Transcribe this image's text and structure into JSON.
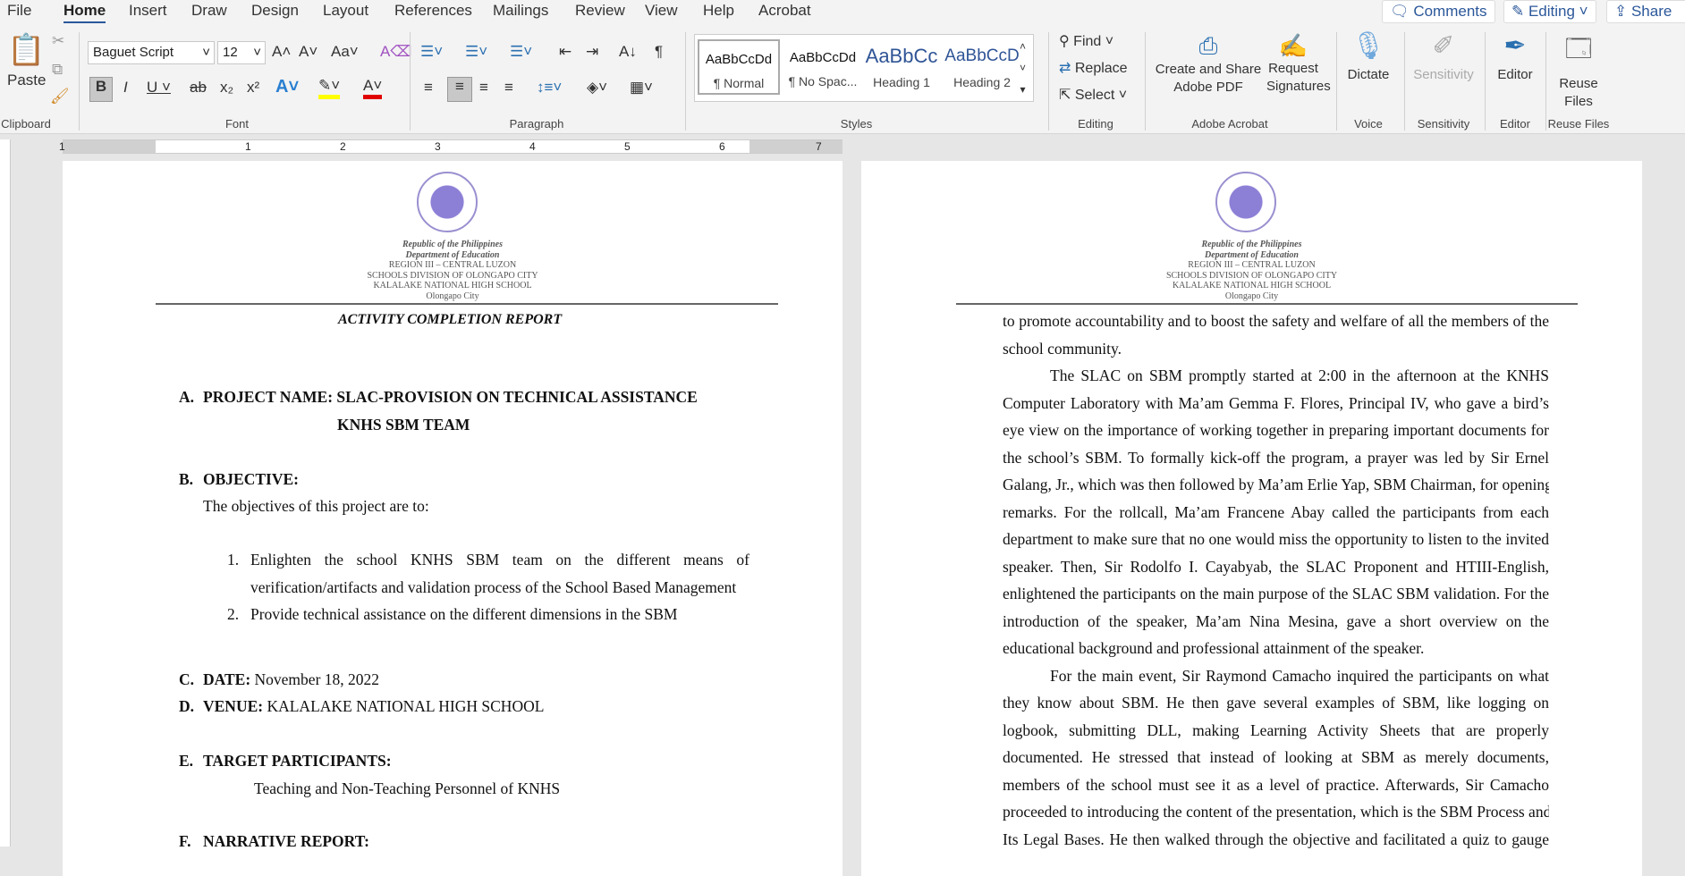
{
  "tabs": [
    "File",
    "Home",
    "Insert",
    "Draw",
    "Design",
    "Layout",
    "References",
    "Mailings",
    "Review",
    "View",
    "Help",
    "Acrobat"
  ],
  "top_buttons": {
    "comments": "Comments",
    "editing": "Editing",
    "share": "Share"
  },
  "clipboard": {
    "paste": "Paste",
    "label": "Clipboard"
  },
  "font": {
    "name": "Baguet Script",
    "size": "12",
    "label": "Font"
  },
  "paragraph": {
    "label": "Paragraph"
  },
  "styles": {
    "items": [
      {
        "preview": "AaBbCcDd",
        "name": "¶ Normal"
      },
      {
        "preview": "AaBbCcDd",
        "name": "¶ No Spac..."
      },
      {
        "preview": "AaBbCc",
        "name": "Heading 1"
      },
      {
        "preview": "AaBbCcD",
        "name": "Heading 2"
      }
    ],
    "label": "Styles"
  },
  "editing": {
    "find": "Find",
    "replace": "Replace",
    "select": "Select",
    "label": "Editing"
  },
  "acrobat": {
    "create": "Create and Share Adobe PDF",
    "request": "Request Signatures",
    "label": "Adobe Acrobat"
  },
  "voice": {
    "dictate": "Dictate",
    "label": "Voice"
  },
  "sensitivity": {
    "btn": "Sensitivity",
    "label": "Sensitivity"
  },
  "editor": {
    "btn": "Editor",
    "label": "Editor"
  },
  "reuse": {
    "btn": "Reuse Files",
    "label": "Reuse Files"
  },
  "ruler_numbers": [
    "1",
    "1",
    "2",
    "3",
    "4",
    "5",
    "6",
    "7"
  ],
  "header": {
    "republic": "Republic of the Philippines",
    "dept": "Department of Education",
    "region": "REGION III – CENTRAL LUZON",
    "division": "SCHOOLS DIVISION OF OLONGAPO CITY",
    "school": "KALALAKE NATIONAL HIGH SCHOOL",
    "city": "Olongapo City"
  },
  "page1": {
    "title": "ACTIVITY COMPLETION REPORT",
    "a_label": "A.",
    "a_text": "PROJECT NAME: SLAC-PROVISION ON TECHNICAL ASSISTANCE",
    "a_text2": "KNHS SBM TEAM",
    "b_label": "B.",
    "b_text": "OBJECTIVE:",
    "b_intro": "The objectives of this project are to:",
    "obj1_num": "1.",
    "obj1_l1": "Enlighten the school KNHS SBM team on the different means of",
    "obj1_l2": "verification/artifacts and validation process of the School Based Management",
    "obj2_num": "2.",
    "obj2": "Provide technical assistance on the different dimensions in the SBM",
    "c_label": "C.",
    "c_key": "DATE:",
    "c_val": " November 18, 2022",
    "d_label": "D.",
    "d_key": "VENUE:",
    "d_val": " KALALAKE NATIONAL HIGH SCHOOL",
    "e_label": "E.",
    "e_text": "TARGET PARTICIPANTS:",
    "e_val": "Teaching and Non-Teaching Personnel of KNHS",
    "f_label": "F.",
    "f_text": "NARRATIVE REPORT:"
  },
  "page2": {
    "lines": [
      {
        "text": "to promote accountability and to boost the safety and welfare of all the members of the"
      },
      {
        "text": "school community.",
        "last": true
      },
      {
        "text": "The SLAC on SBM promptly started at 2:00 in the afternoon at the KNHS",
        "indent": true
      },
      {
        "text": "Computer Laboratory with Ma’am Gemma F. Flores, Principal IV, who gave a bird’s"
      },
      {
        "text": "eye view on the importance of working together in preparing important documents for"
      },
      {
        "text": "the school’s SBM. To formally kick-off the program, a prayer was led by Sir Ernel"
      },
      {
        "text": "Galang, Jr., which was then followed by Ma’am Erlie Yap, SBM Chairman, for opening"
      },
      {
        "text": "remarks. For the rollcall, Ma’am Francene Abay called the participants from each"
      },
      {
        "text": "department to make sure that no one would miss the opportunity to listen to the invited"
      },
      {
        "text": "speaker. Then, Sir Rodolfo I. Cayabyab, the SLAC Proponent and HTIII-English,"
      },
      {
        "text": "enlightened the participants on the main purpose of the SLAC SBM validation. For the"
      },
      {
        "text": "introduction of the speaker, Ma’am Nina Mesina, gave a short overview on the"
      },
      {
        "text": "educational background and professional attainment of the speaker.",
        "last": true
      },
      {
        "text": "For the main event, Sir Raymond Camacho inquired the participants on what",
        "indent": true
      },
      {
        "text": "they know about SBM. He then gave several examples of SBM, like logging on"
      },
      {
        "text": "logbook, submitting DLL, making Learning Activity Sheets that are properly"
      },
      {
        "text": "documented. He stressed that instead of looking at SBM as merely documents,"
      },
      {
        "text": "members of the school must see it as a level of practice. Afterwards, Sir Camacho"
      },
      {
        "text": "proceeded to introducing the content of the presentation, which is the SBM Process and"
      },
      {
        "text": "Its Legal Bases. He then walked through the objective and facilitated a quiz to gauge"
      }
    ]
  }
}
